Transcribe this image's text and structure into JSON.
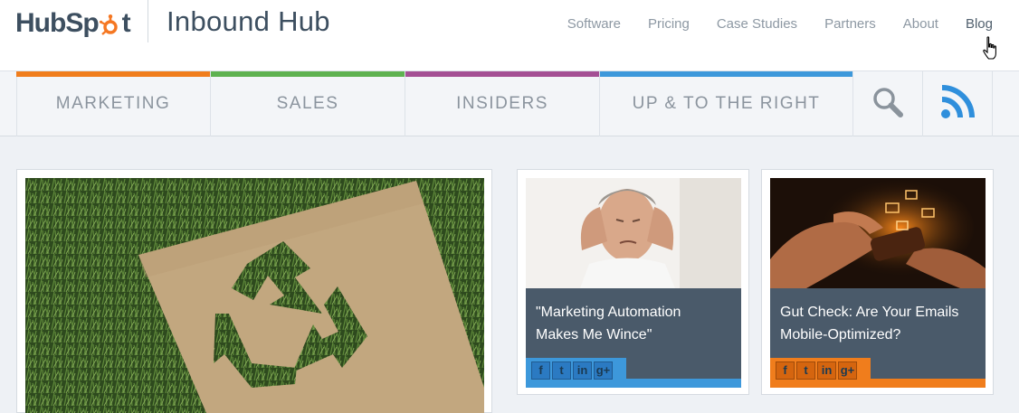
{
  "header": {
    "logo_prefix": "HubSp",
    "logo_suffix": "t",
    "hub_title": "Inbound Hub",
    "nav": [
      {
        "label": "Software"
      },
      {
        "label": "Pricing"
      },
      {
        "label": "Case Studies"
      },
      {
        "label": "Partners"
      },
      {
        "label": "About"
      },
      {
        "label": "Blog"
      }
    ],
    "brand_color": "#f57722"
  },
  "categories": [
    {
      "label": "MARKETING",
      "color": "#f07d1c"
    },
    {
      "label": "SALES",
      "color": "#5eb250"
    },
    {
      "label": "INSIDERS",
      "color": "#a44f94"
    },
    {
      "label": "UP & TO THE RIGHT",
      "color": "#3d98db"
    }
  ],
  "icons": {
    "search": "search-icon",
    "rss": "rss-icon",
    "cursor": "hand-cursor-icon"
  },
  "posts": [
    {
      "title_line1": "",
      "title_line2": "",
      "image": "recycle-cardboard-on-grass"
    },
    {
      "title_line1": "\"Marketing Automation",
      "title_line2": "Makes Me Wince\"",
      "accent": "#3d98db",
      "image": "man-with-headache"
    },
    {
      "title_line1": "Gut Check: Are Your Emails",
      "title_line2": "Mobile-Optimized?",
      "accent": "#f07d1c",
      "image": "hands-holding-phone"
    }
  ],
  "social": {
    "facebook": "f",
    "twitter": "t",
    "linkedin": "in",
    "googleplus": "g+"
  }
}
